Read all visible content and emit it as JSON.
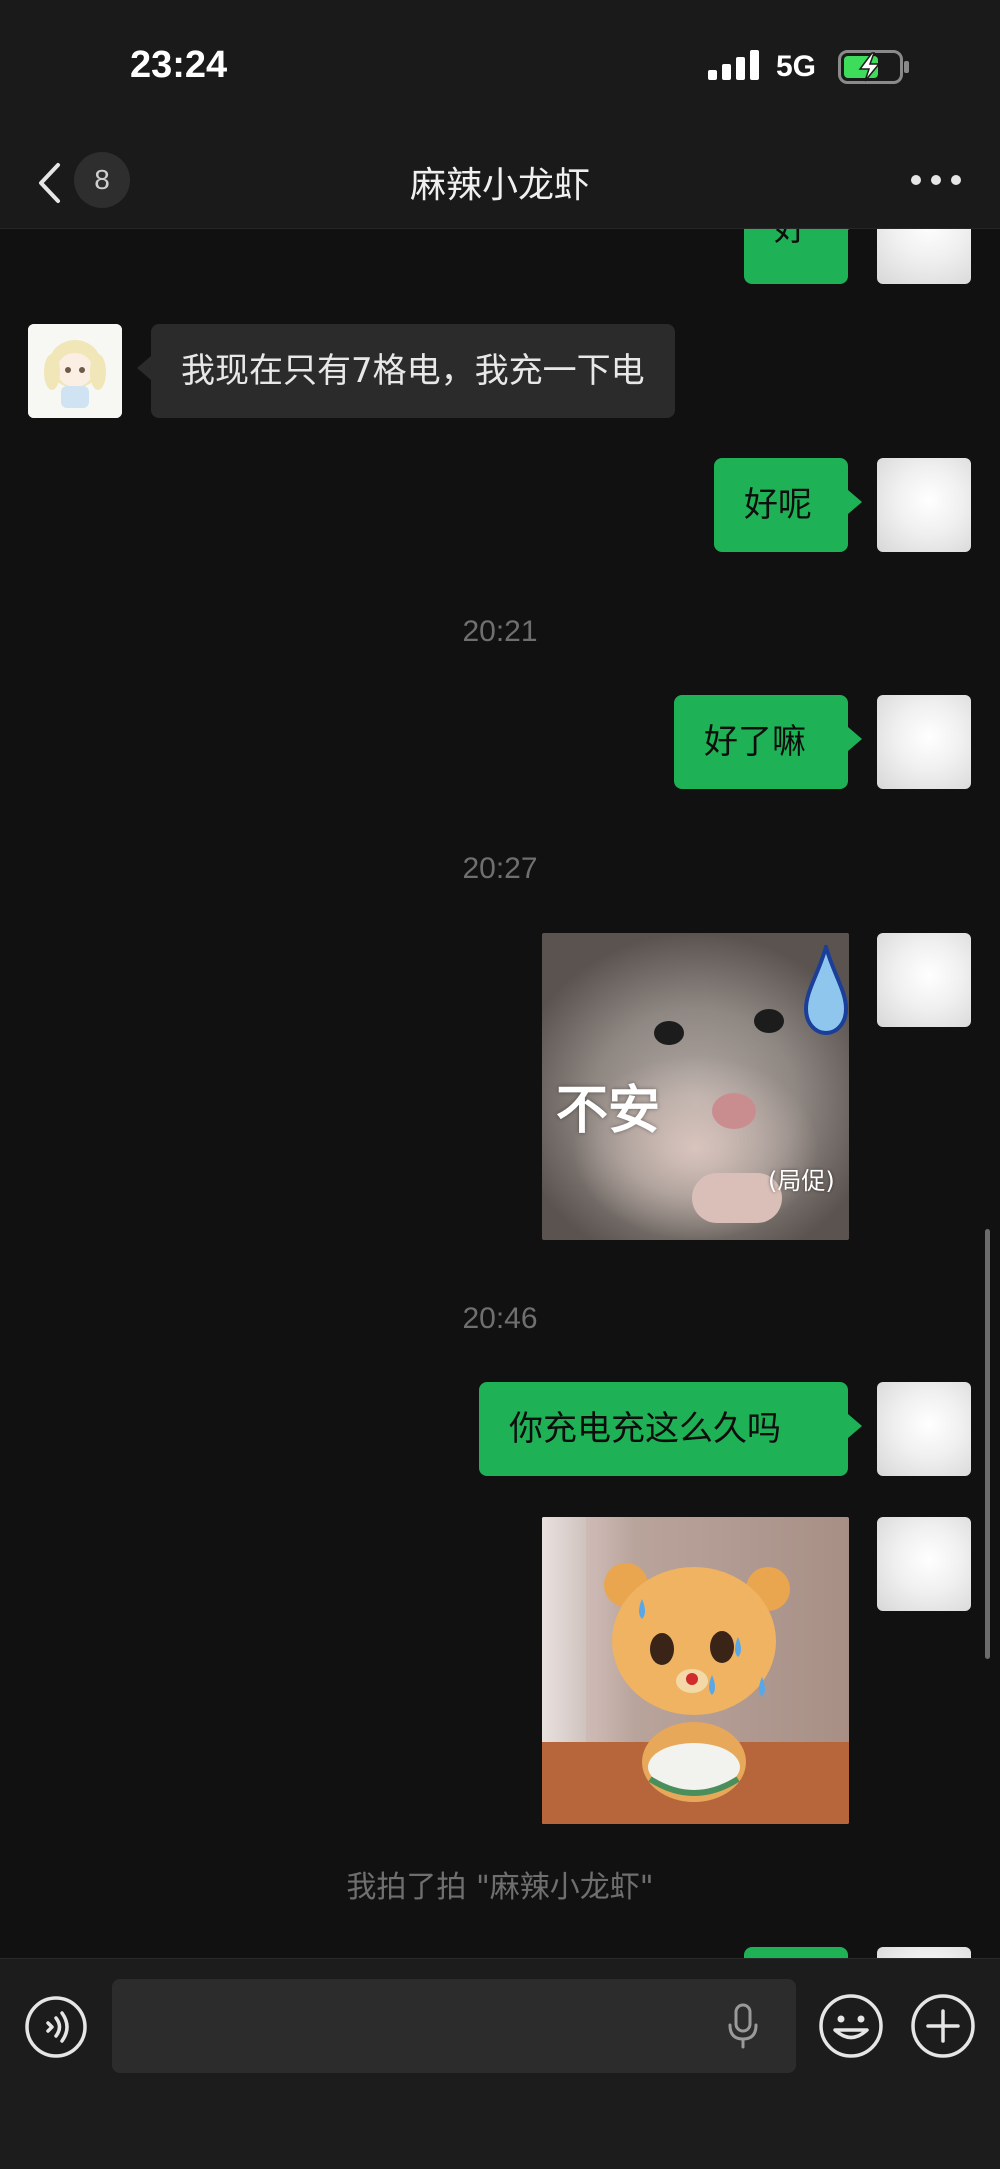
{
  "status_bar": {
    "time": "23:24",
    "network": "5G",
    "battery_state": "charging"
  },
  "nav": {
    "back_count": "8",
    "title": "麻辣小龙虾"
  },
  "messages": [
    {
      "type": "text",
      "direction": "outgoing",
      "text": "好"
    },
    {
      "type": "text",
      "direction": "incoming",
      "text": "我现在只有7格电，我充一下电"
    },
    {
      "type": "text",
      "direction": "outgoing",
      "text": "好呢"
    },
    {
      "type": "timestamp",
      "text": "20:21"
    },
    {
      "type": "text",
      "direction": "outgoing",
      "text": "好了嘛"
    },
    {
      "type": "timestamp",
      "text": "20:27"
    },
    {
      "type": "sticker",
      "direction": "outgoing",
      "caption_main": "不安",
      "caption_sub": "(局促)",
      "icon": "hamster-sticker"
    },
    {
      "type": "timestamp",
      "text": "20:46"
    },
    {
      "type": "text",
      "direction": "outgoing",
      "text": "你充电充这么久吗"
    },
    {
      "type": "sticker",
      "direction": "outgoing",
      "icon": "bear-sticker"
    },
    {
      "type": "system",
      "text": "我拍了拍 \"麻辣小龙虾\""
    }
  ],
  "input": {
    "value": "",
    "placeholder": ""
  },
  "colors": {
    "background": "#111111",
    "bar": "#1a1a1a",
    "outgoing_bubble": "#1fb155",
    "incoming_bubble": "#2b2b2b",
    "battery_charging": "#3ddc5a"
  }
}
